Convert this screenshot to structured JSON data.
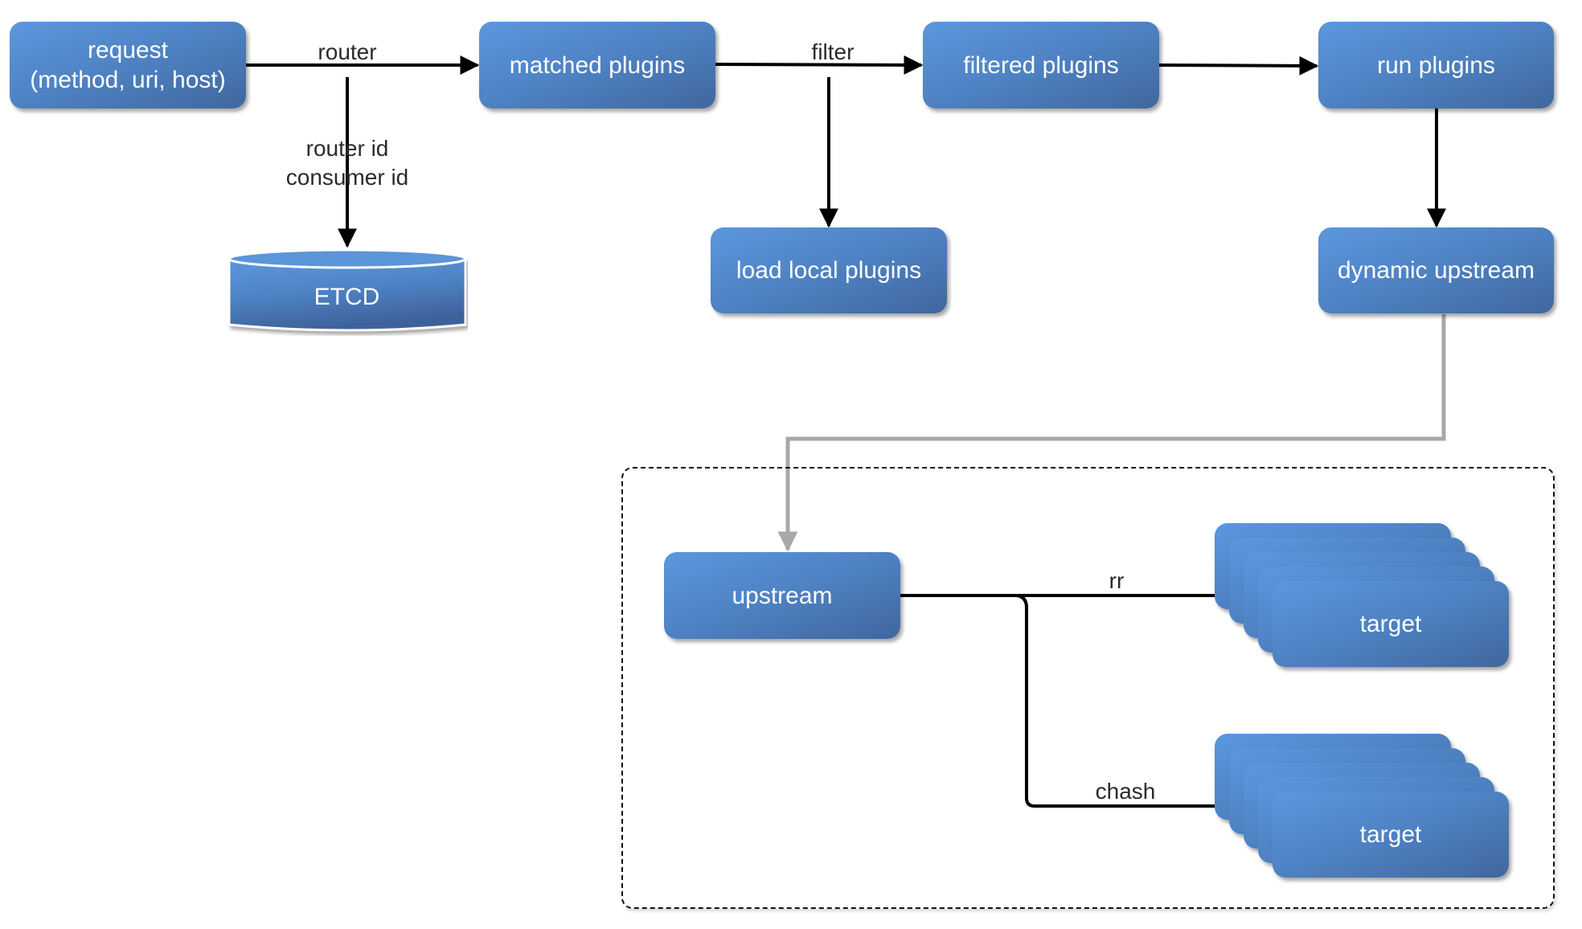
{
  "diagram": {
    "nodes": {
      "request": {
        "lines": [
          "request",
          "(method, uri, host)"
        ]
      },
      "matched_plugins": {
        "label": "matched plugins"
      },
      "filtered_plugins": {
        "label": "filtered plugins"
      },
      "run_plugins": {
        "label": "run plugins"
      },
      "load_local_plugins": {
        "label": "load local plugins"
      },
      "dynamic_upstream": {
        "label": "dynamic upstream"
      },
      "etcd": {
        "label": "ETCD",
        "shape": "cylinder"
      },
      "upstream": {
        "label": "upstream"
      },
      "target_rr": {
        "label": "target",
        "stack_count": 5
      },
      "target_chash": {
        "label": "target",
        "stack_count": 5
      }
    },
    "edges": [
      {
        "from": "request",
        "to": "matched_plugins",
        "label": "router"
      },
      {
        "from": "request",
        "to": "etcd",
        "label_lines": [
          "router id",
          "consumer id"
        ]
      },
      {
        "from": "matched_plugins",
        "to": "filtered_plugins",
        "label": "filter"
      },
      {
        "from": "matched_plugins",
        "to": "load_local_plugins",
        "label": ""
      },
      {
        "from": "filtered_plugins",
        "to": "run_plugins",
        "label": ""
      },
      {
        "from": "run_plugins",
        "to": "dynamic_upstream",
        "label": ""
      },
      {
        "from": "dynamic_upstream",
        "to": "upstream",
        "label": "",
        "style": "gray"
      },
      {
        "from": "upstream",
        "to": "target_rr",
        "label": "rr"
      },
      {
        "from": "upstream",
        "to": "target_chash",
        "label": "chash"
      }
    ],
    "colors": {
      "node_fill_light": "#5c97dd",
      "node_fill_dark": "#40679e",
      "edge": "#000000",
      "edge_gray": "#a8a8a8",
      "label_text": "#2b2b2b",
      "node_text": "#ffffff"
    }
  }
}
